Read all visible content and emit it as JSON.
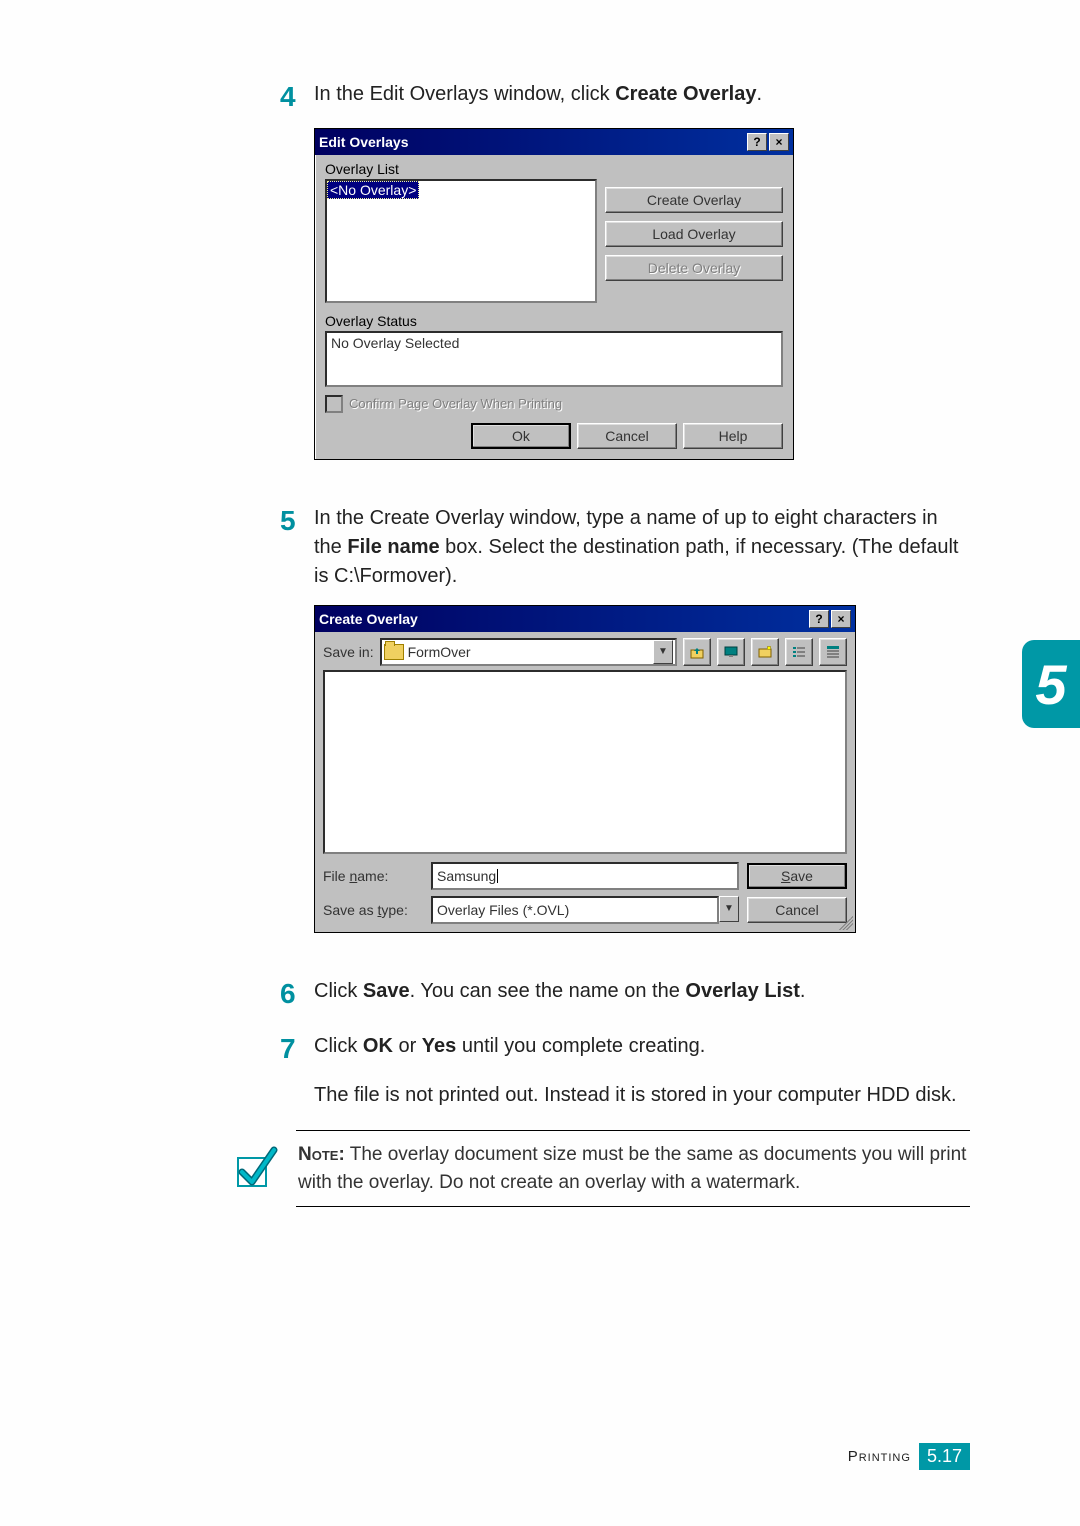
{
  "steps": {
    "4": {
      "num": "4",
      "text_pre": "In the Edit Overlays window, click ",
      "bold": "Create Overlay",
      "text_post": "."
    },
    "5": {
      "num": "5",
      "line1_pre": "In the Create Overlay window, type a name of up to eight characters in the ",
      "line1_bold": "File name",
      "line1_post": " box. Select the destination path, if necessary. (The default is C:\\Formover)."
    },
    "6": {
      "num": "6",
      "text_pre": "Click ",
      "bold1": "Save",
      "mid": ". You can see the name on the ",
      "bold2": "Overlay List",
      "post": "."
    },
    "7": {
      "num": "7",
      "text_pre": "Click ",
      "bold1": "OK",
      "mid1": " or ",
      "bold2": "Yes",
      "mid2": " until you complete creating.",
      "para2": "The file is not printed out. Instead it is stored in your computer HDD disk."
    }
  },
  "edit_overlays": {
    "title": "Edit Overlays",
    "list_label": "Overlay List",
    "list_item": "<No Overlay>",
    "btn_create": "Create Overlay",
    "btn_load": "Load Overlay",
    "btn_delete": "Delete Overlay",
    "status_label": "Overlay Status",
    "status_text": "No Overlay Selected",
    "checkbox": "Confirm Page Overlay When Printing",
    "btn_ok": "Ok",
    "btn_cancel": "Cancel",
    "btn_help": "Help"
  },
  "create_overlay": {
    "title": "Create Overlay",
    "savein_label": "Save in:",
    "savein_value": "FormOver",
    "filename_label": "File name:",
    "filename_value": "Samsung",
    "saveas_label": "Save as type:",
    "saveas_value": "Overlay Files (*.OVL)",
    "btn_save": "Save",
    "btn_cancel": "Cancel"
  },
  "note": {
    "head": "Note:",
    "body": " The overlay document size must be the same as documents you will print with the overlay. Do not create an overlay with a watermark."
  },
  "side_tab": "5",
  "footer": {
    "section": "Printing",
    "chapter": "5",
    "page": "17"
  }
}
